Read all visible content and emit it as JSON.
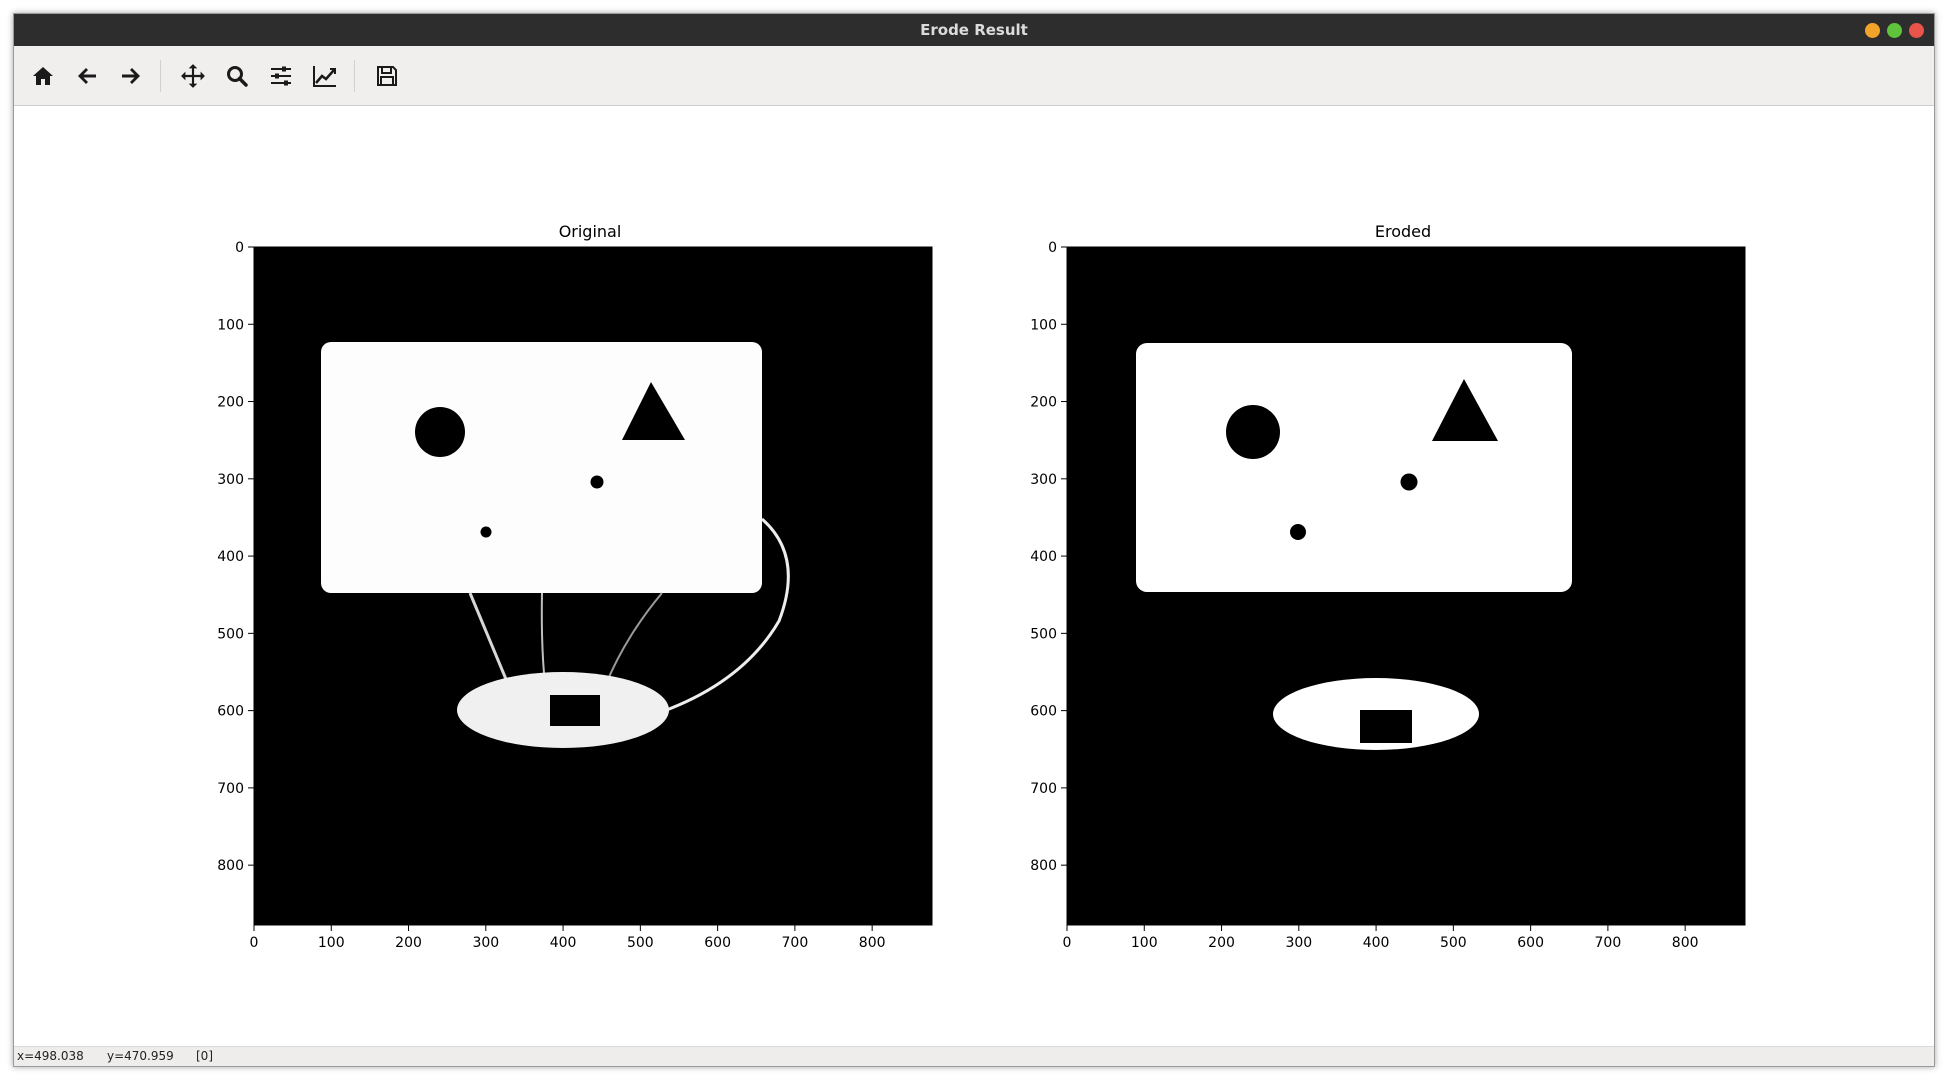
{
  "window": {
    "title": "Erode Result"
  },
  "toolbar": {
    "buttons": [
      {
        "icon": "home-icon",
        "tooltip": ""
      },
      {
        "icon": "arrow-left-icon",
        "tooltip": ""
      },
      {
        "icon": "arrow-right-icon",
        "tooltip": ""
      },
      {
        "icon": "move-icon",
        "tooltip": ""
      },
      {
        "icon": "zoom-icon",
        "tooltip": ""
      },
      {
        "icon": "sliders-icon",
        "tooltip": ""
      },
      {
        "icon": "line-chart-icon",
        "tooltip": ""
      },
      {
        "icon": "save-icon",
        "tooltip": ""
      }
    ]
  },
  "plots": {
    "left": {
      "title": "Original",
      "xticks": [
        "0",
        "100",
        "200",
        "300",
        "400",
        "500",
        "600",
        "700",
        "800"
      ],
      "yticks": [
        "0",
        "100",
        "200",
        "300",
        "400",
        "500",
        "600",
        "700",
        "800"
      ]
    },
    "right": {
      "title": "Eroded",
      "xticks": [
        "0",
        "100",
        "200",
        "300",
        "400",
        "500",
        "600",
        "700",
        "800"
      ],
      "yticks": [
        "0",
        "100",
        "200",
        "300",
        "400",
        "500",
        "600",
        "700",
        "800"
      ]
    }
  },
  "status": {
    "x": "x=498.038",
    "y": "y=470.959",
    "value": "[0]"
  },
  "colors": {
    "titlebar": "#2d2d2d",
    "toolbar": "#f1efee",
    "image_bg": "#000000",
    "image_fg": "#ffffff"
  }
}
